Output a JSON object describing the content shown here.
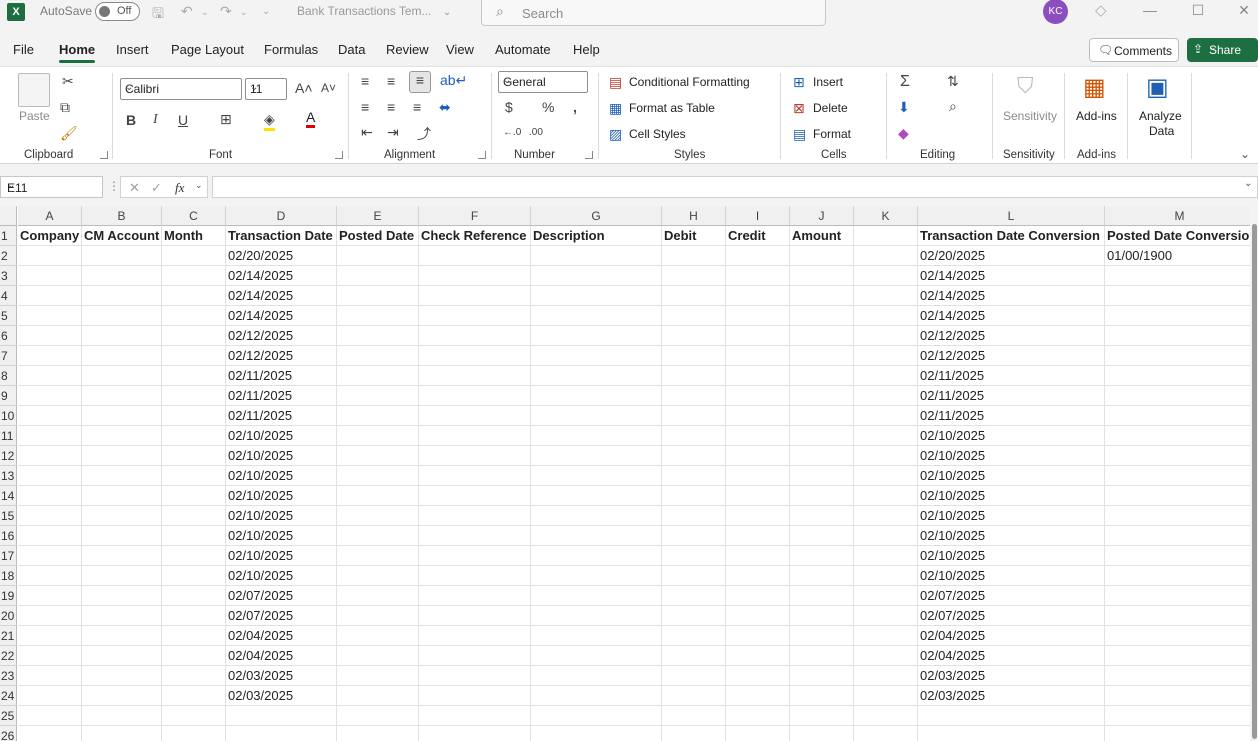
{
  "titlebar": {
    "app_icon": "X",
    "autosave_label": "AutoSave",
    "autosave_state": "Off",
    "filename": "Bank Transactions Tem...",
    "search_placeholder": "Search",
    "user_initials": "KC"
  },
  "menu": [
    "File",
    "Home",
    "Insert",
    "Page Layout",
    "Formulas",
    "Data",
    "Review",
    "View",
    "Automate",
    "Help"
  ],
  "menu_active": "Home",
  "comments_label": "Comments",
  "share_label": "Share",
  "ribbon": {
    "clipboard": {
      "paste": "Paste",
      "group": "Clipboard"
    },
    "font": {
      "name": "Calibri",
      "size": "11",
      "group": "Font"
    },
    "alignment": {
      "group": "Alignment"
    },
    "number": {
      "format": "General",
      "group": "Number"
    },
    "styles": {
      "conditional": "Conditional Formatting",
      "table": "Format as Table",
      "cell": "Cell Styles",
      "group": "Styles"
    },
    "cells": {
      "insert": "Insert",
      "delete": "Delete",
      "format": "Format",
      "group": "Cells"
    },
    "editing": {
      "group": "Editing"
    },
    "sensitivity": {
      "label": "Sensitivity",
      "group": "Sensitivity"
    },
    "addins": {
      "label": "Add-ins",
      "group": "Add-ins"
    },
    "analyze": {
      "line1": "Analyze",
      "line2": "Data"
    }
  },
  "formula_bar": {
    "name_box": "E11",
    "formula": ""
  },
  "columns": [
    "A",
    "B",
    "C",
    "D",
    "E",
    "F",
    "G",
    "H",
    "I",
    "J",
    "K",
    "L",
    "M"
  ],
  "headers": [
    "Company",
    "CM Account",
    "Month",
    "Transaction Date",
    "Posted Date",
    "Check Reference",
    "Description",
    "Debit",
    "Credit",
    "Amount",
    "",
    "Transaction Date Conversion",
    "Posted Date Conversio"
  ],
  "transaction_dates": [
    "02/20/2025",
    "02/14/2025",
    "02/14/2025",
    "02/14/2025",
    "02/12/2025",
    "02/12/2025",
    "02/11/2025",
    "02/11/2025",
    "02/11/2025",
    "02/10/2025",
    "02/10/2025",
    "02/10/2025",
    "02/10/2025",
    "02/10/2025",
    "02/10/2025",
    "02/10/2025",
    "02/10/2025",
    "02/07/2025",
    "02/07/2025",
    "02/04/2025",
    "02/04/2025",
    "02/03/2025",
    "02/03/2025"
  ],
  "posted_date_conversion_first": "01/00/1900",
  "row_numbers": [
    "1",
    "2",
    "3",
    "4",
    "5",
    "6",
    "7",
    "8",
    "9",
    "10",
    "11",
    "12",
    "13",
    "14",
    "15",
    "16",
    "17",
    "18",
    "19",
    "20",
    "21",
    "22",
    "23",
    "24",
    "25",
    "26"
  ]
}
